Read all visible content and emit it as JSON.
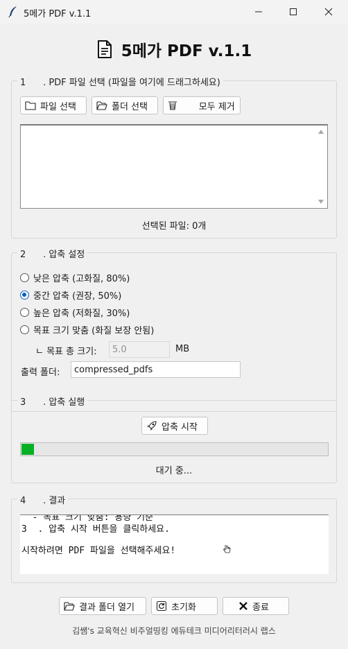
{
  "window": {
    "title": "5메가 PDF v.1.1",
    "app_icon": "feather-icon"
  },
  "header": {
    "title": "5메가 PDF v.1.1",
    "icon": "document-icon"
  },
  "section1": {
    "label": "1\t. PDF 파일 선택 (파일을 여기에 드래그하세요)",
    "select_file_button": "파일 선택",
    "select_folder_button": "폴더 선택",
    "remove_all_button": "      모두 제거",
    "selected_count": "선택된 파일: 0개"
  },
  "section2": {
    "label": "2\t. 압축 설정",
    "options": [
      {
        "label": "낮은 압축 (고화질, 80%)",
        "checked": false
      },
      {
        "label": "중간 압축 (권장, 50%)",
        "checked": true
      },
      {
        "label": "높은 압축 (저화질, 30%)",
        "checked": false
      },
      {
        "label": "목표 크기 맞춤 (화질 보장 안됨)",
        "checked": false
      }
    ],
    "target_size_label": "ㄴ 목표 총 크기:",
    "target_size_value": "5.0",
    "target_size_unit": "MB",
    "output_folder_label": "출력 폴더:",
    "output_folder_value": "compressed_pdfs"
  },
  "section3": {
    "label": "3\t. 압축 실행",
    "start_button": "압축 시작",
    "progress": 0.04,
    "status": "대기 중..."
  },
  "section4": {
    "label": "4\t. 결과",
    "lines": [
      "  - 목표 크기 맞춤: 용량 기준",
      "3  . 압축 시작 버튼을 클릭하세요.",
      "",
      "시작하려면 PDF 파일을 선택해주세요!"
    ]
  },
  "bottom": {
    "open_folder_button": "결과 폴더 열기",
    "reset_button": "초기화",
    "exit_button": "종료"
  },
  "footer": "김쌤's 교육혁신 비주얼띵킹 에듀테크 미디어리터러시 랩스",
  "colors": {
    "progress": "#06b025",
    "radio_accent": "#0a5fc4"
  }
}
